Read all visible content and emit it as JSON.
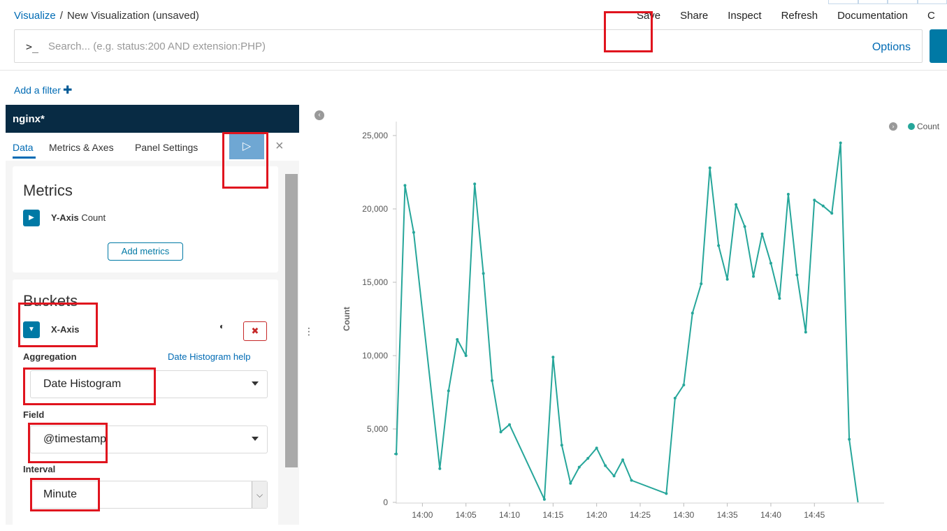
{
  "breadcrumb": {
    "root": "Visualize",
    "separator": "/",
    "title": "New Visualization (unsaved)"
  },
  "top_menu": [
    "Save",
    "Share",
    "Inspect",
    "Refresh",
    "Documentation",
    "C"
  ],
  "search": {
    "prompt": ">_",
    "placeholder": "Search... (e.g. status:200 AND extension:PHP)",
    "value": "",
    "options_label": "Options"
  },
  "filter": {
    "add_label": "Add a filter",
    "plus_icon": "plus-icon"
  },
  "sidebar": {
    "index_pattern": "nginx*",
    "tabs": [
      "Data",
      "Metrics & Axes",
      "Panel Settings"
    ],
    "apply_icon": "▷",
    "discard_icon": "×",
    "metrics": {
      "title": "Metrics",
      "item_bold": "Y-Axis",
      "item_label": "Count",
      "add_button": "Add metrics"
    },
    "buckets": {
      "title": "Buckets",
      "item_label": "X-Axis",
      "remove_icon": "✖",
      "aggregation_label": "Aggregation",
      "aggregation_help": "Date Histogram help",
      "aggregation_value": "Date Histogram",
      "field_label": "Field",
      "field_value": "@timestamp",
      "interval_label": "Interval",
      "interval_value": "Minute"
    }
  },
  "colors": {
    "line": "#26a69a",
    "link": "#006bb4",
    "highlight": "#e0141e"
  },
  "chart_data": {
    "type": "line",
    "ylabel": "Count",
    "legend": [
      "Count"
    ],
    "legend_position": "top-right",
    "ylim": [
      0,
      25000
    ],
    "yticks": [
      0,
      5000,
      10000,
      15000,
      20000,
      25000
    ],
    "ytick_labels": [
      "0",
      "5,000",
      "10,000",
      "15,000",
      "20,000",
      "25,000"
    ],
    "xlim": [
      "13:57",
      "14:53"
    ],
    "xtick_labels": [
      "14:00",
      "14:05",
      "14:10",
      "14:15",
      "14:20",
      "14:25",
      "14:30",
      "14:35",
      "14:40",
      "14:45"
    ],
    "x": [
      "13:57",
      "13:58",
      "13:59",
      "14:02",
      "14:03",
      "14:04",
      "14:05",
      "14:06",
      "14:07",
      "14:08",
      "14:09",
      "14:10",
      "14:14",
      "14:15",
      "14:16",
      "14:17",
      "14:18",
      "14:19",
      "14:20",
      "14:21",
      "14:22",
      "14:23",
      "14:24",
      "14:28",
      "14:29",
      "14:30",
      "14:31",
      "14:32",
      "14:33",
      "14:34",
      "14:35",
      "14:36",
      "14:37",
      "14:38",
      "14:39",
      "14:40",
      "14:41",
      "14:42",
      "14:43",
      "14:44",
      "14:45",
      "14:46",
      "14:47",
      "14:48",
      "14:49"
    ],
    "values": [
      3300,
      21600,
      18400,
      2300,
      7600,
      11100,
      10000,
      21700,
      15600,
      8300,
      4800,
      5300,
      200,
      9900,
      3900,
      1300,
      2400,
      3000,
      3700,
      2500,
      1800,
      2900,
      1500,
      600,
      7100,
      8000,
      12900,
      14900,
      22800,
      17500,
      15200,
      20300,
      18800,
      15400,
      18300,
      16300,
      13900,
      21000,
      15500,
      11600,
      20600,
      20200,
      19700,
      24500,
      4300
    ]
  }
}
